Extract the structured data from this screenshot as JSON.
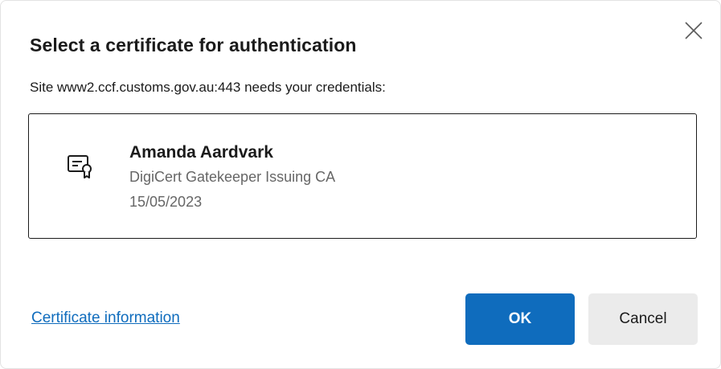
{
  "dialog": {
    "title": "Select a certificate for authentication",
    "subtitle": "Site www2.ccf.customs.gov.au:443 needs your credentials:",
    "close_icon": "close-icon"
  },
  "certificate": {
    "icon": "certificate-icon",
    "name": "Amanda Aardvark",
    "issuer": "DigiCert Gatekeeper Issuing CA",
    "date": "15/05/2023"
  },
  "footer": {
    "info_link": "Certificate information",
    "ok_label": "OK",
    "cancel_label": "Cancel"
  },
  "colors": {
    "accent": "#0f6cbd",
    "secondary_button": "#ebebeb",
    "muted_text": "#666666"
  }
}
